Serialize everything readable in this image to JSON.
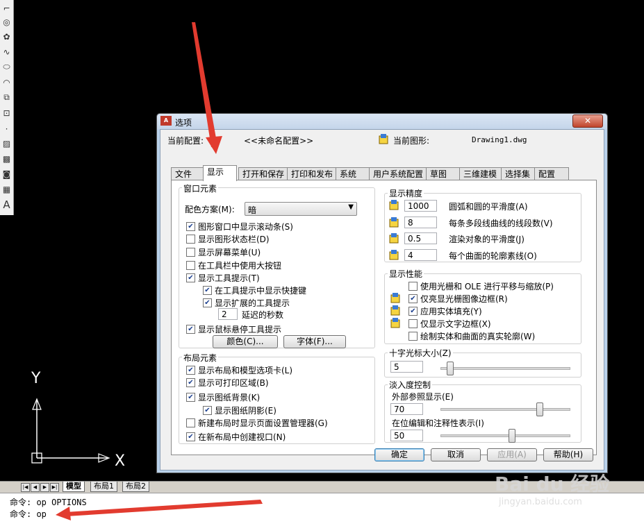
{
  "dialog": {
    "title": "选项",
    "close": "✕",
    "current_profile_label": "当前配置:",
    "current_profile_value": "<<未命名配置>>",
    "current_drawing_label": "当前图形:",
    "current_drawing_value": "Drawing1.dwg",
    "tabs": [
      "文件",
      "显示",
      "打开和保存",
      "打印和发布",
      "系统",
      "用户系统配置",
      "草图",
      "三维建模",
      "选择集",
      "配置"
    ],
    "active_tab": "显示",
    "window_elements": {
      "title": "窗口元素",
      "color_scheme_label": "配色方案(M):",
      "color_scheme_value": "暗",
      "options": [
        {
          "label": "图形窗口中显示滚动条(S)",
          "checked": true
        },
        {
          "label": "显示图形状态栏(D)",
          "checked": false
        },
        {
          "label": "显示屏幕菜单(U)",
          "checked": false
        },
        {
          "label": "在工具栏中使用大按钮",
          "checked": false
        },
        {
          "label": "显示工具提示(T)",
          "checked": true
        }
      ],
      "sub_options": [
        {
          "label": "在工具提示中显示快捷键",
          "checked": true
        },
        {
          "label": "显示扩展的工具提示",
          "checked": true
        }
      ],
      "delay_value": "2",
      "delay_label": "延迟的秒数",
      "rollover_label": "显示鼠标悬停工具提示",
      "rollover_checked": true,
      "colors_button": "颜色(C)...",
      "fonts_button": "字体(F)..."
    },
    "layout_elements": {
      "title": "布局元素",
      "options": [
        {
          "label": "显示布局和模型选项卡(L)",
          "checked": true
        },
        {
          "label": "显示可打印区域(B)",
          "checked": true
        },
        {
          "label": "显示图纸背景(K)",
          "checked": true
        },
        {
          "label": "显示图纸阴影(E)",
          "checked": true
        },
        {
          "label": "新建布局时显示页面设置管理器(G)",
          "checked": false
        },
        {
          "label": "在新布局中创建视口(N)",
          "checked": true
        }
      ]
    },
    "display_resolution": {
      "title": "显示精度",
      "items": [
        {
          "value": "1000",
          "label": "圆弧和圆的平滑度(A)"
        },
        {
          "value": "8",
          "label": "每条多段线曲线的线段数(V)"
        },
        {
          "value": "0.5",
          "label": "渲染对象的平滑度(J)"
        },
        {
          "value": "4",
          "label": "每个曲面的轮廓素线(O)"
        }
      ]
    },
    "display_performance": {
      "title": "显示性能",
      "options": [
        {
          "label": "使用光栅和 OLE 进行平移与缩放(P)",
          "checked": false
        },
        {
          "label": "仅亮显光栅图像边框(R)",
          "checked": true
        },
        {
          "label": "应用实体填充(Y)",
          "checked": true
        },
        {
          "label": "仅显示文字边框(X)",
          "checked": false
        },
        {
          "label": "绘制实体和曲面的真实轮廓(W)",
          "checked": false
        }
      ]
    },
    "crosshair": {
      "title": "十字光标大小(Z)",
      "value": "5",
      "level": 5
    },
    "fade": {
      "title": "淡入度控制",
      "xref_label": "外部参照显示(E)",
      "xref_value": "70",
      "xref_level": 70,
      "inplace_label": "在位编辑和注释性表示(I)",
      "inplace_value": "50",
      "inplace_level": 50
    },
    "buttons": {
      "ok": "确定",
      "cancel": "取消",
      "apply": "应用(A)",
      "help": "帮助(H)"
    }
  },
  "layout_tabs": [
    "模型",
    "布局1",
    "布局2"
  ],
  "ucs": {
    "y": "Y",
    "x": "X"
  },
  "command_line": [
    "命令: op OPTIONS",
    "命令: op"
  ],
  "watermark": {
    "brand": "Bai du 经验",
    "url": "jingyan.baidu.com"
  },
  "colors": {
    "annotation_arrow": "#e23b2f",
    "background": "#000000"
  }
}
